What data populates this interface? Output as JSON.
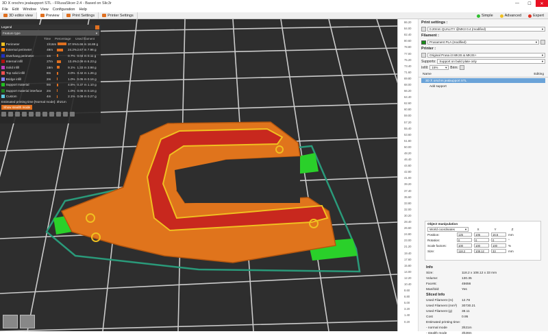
{
  "window": {
    "title": "3D Ⅹ orschrs jealaupport STL - FRusaSlicer-2.4 - Based on Slic3r",
    "controls": [
      "—",
      "☐",
      "✕"
    ]
  },
  "menubar": [
    "File",
    "Edit",
    "Window",
    "View",
    "Configuration",
    "Help"
  ],
  "tabs": [
    {
      "label": "3D editor view"
    },
    {
      "label": "Preview"
    },
    {
      "label": "Print Settings"
    },
    {
      "label": "Printer Settings"
    }
  ],
  "modes": [
    {
      "label": "Simple",
      "color": "#2fbf2f"
    },
    {
      "label": "Advanced",
      "color": "#f0c020"
    },
    {
      "label": "Expert",
      "color": "#e03020"
    }
  ],
  "legend": {
    "title": "Legend",
    "view_type": "Feature type",
    "columns": [
      "",
      "Time",
      "Percentage",
      "",
      "Used filament"
    ],
    "rows": [
      {
        "name": "Perimeter",
        "time": "1h16m",
        "pct": "37.9%",
        "len": "5.66 m 16.88 g",
        "color": "#f0c020",
        "bar": 0.9
      },
      {
        "name": "External perimeter",
        "time": "49m",
        "pct": "24.2%",
        "len": "2.67 m 7.96 g",
        "color": "#ff7f00",
        "bar": 0.6
      },
      {
        "name": "Overhang perimeter",
        "time": "1m",
        "pct": "0.7%",
        "len": "0.04 m 0.11 g",
        "color": "#2030c0",
        "bar": 0.05
      },
      {
        "name": "Internal infill",
        "time": "27m",
        "pct": "13.4%",
        "len": "2.09 m 6.23 g",
        "color": "#b01010",
        "bar": 0.35
      },
      {
        "name": "Solid infill",
        "time": "18m",
        "pct": "9.1%",
        "len": "1.33 m 3.98 g",
        "color": "#c040c0",
        "bar": 0.25
      },
      {
        "name": "Top solid infill",
        "time": "8m",
        "pct": "4.0%",
        "len": "0.42 m 1.26 g",
        "color": "#f05050",
        "bar": 0.12
      },
      {
        "name": "Bridge infill",
        "time": "2m",
        "pct": "1.0%",
        "len": "0.05 m 0.16 g",
        "color": "#8080ff",
        "bar": 0.04
      },
      {
        "name": "Support material",
        "time": "9m",
        "pct": "4.5%",
        "len": "0.37 m 1.10 g",
        "color": "#20c020",
        "bar": 0.13
      },
      {
        "name": "Support material interface",
        "time": "2m",
        "pct": "1.0%",
        "len": "0.06 m 0.18 g",
        "color": "#208020",
        "bar": 0.04
      },
      {
        "name": "Custom",
        "time": "4m",
        "pct": "2.1%",
        "len": "0.09 m 0.27 g",
        "color": "#5ec8e0",
        "bar": 0.06
      }
    ],
    "estimated_label": "Estimated printing time [Normal mode]:",
    "estimated_value": "3h21m",
    "show_button": "Show stealth mode"
  },
  "ruler": [
    "86.20",
    "84.00",
    "82.40",
    "80.60",
    "78.80",
    "77.00",
    "75.20",
    "73.40",
    "71.60",
    "69.80",
    "68.00",
    "66.20",
    "64.40",
    "62.60",
    "60.80",
    "59.00",
    "57.20",
    "55.40",
    "53.60",
    "51.80",
    "50.00",
    "48.20",
    "46.40",
    "44.60",
    "42.80",
    "41.00",
    "39.20",
    "37.40",
    "35.60",
    "33.80",
    "32.00",
    "30.20",
    "28.40",
    "26.60",
    "24.80",
    "23.00",
    "21.20",
    "19.40",
    "17.60",
    "15.80",
    "14.00",
    "12.20",
    "10.40",
    "8.60",
    "6.80",
    "5.00",
    "3.20",
    "1.40",
    "0.20"
  ],
  "panel": {
    "print_settings_label": "Print settings :",
    "print_profile": "0.20mm QUALITY @MK3 0.4 (modified)",
    "filament_label": "Filament :",
    "filament_profile": "Prusament PLA (modified)",
    "filament_color": "#1a8f1a",
    "printer_label": "Printer :",
    "printer_profile": "Original Prusa i3 MK3S & MK3S+",
    "supports_label": "Supports:",
    "supports_value": "Support on build plate only",
    "infill_label": "Infill:",
    "infill_value": "15%",
    "brim_label": "Brim:",
    "list_name_header": "Name",
    "list_editing_header": "Editing",
    "object_name": "3D Ⅹ orschrs jealaupport STL",
    "object_child": "Add support"
  },
  "manipulation": {
    "title": "Object manipulation",
    "coord_system": "World coordinates",
    "axes": [
      "X",
      "Y",
      "Z"
    ],
    "rows": [
      {
        "label": "Position:",
        "values": [
          "125",
          "105",
          "16.5"
        ],
        "unit": "mm"
      },
      {
        "label": "Rotation:",
        "values": [
          "0",
          "0",
          "0"
        ],
        "unit": "°"
      },
      {
        "label": "Scale factors:",
        "values": [
          "100",
          "100",
          "100"
        ],
        "unit": "%"
      },
      {
        "label": "Size:",
        "values": [
          "118.2",
          "108.12",
          "33"
        ],
        "unit": "mm"
      }
    ]
  },
  "info": {
    "title": "Info",
    "size": "118.2 x 108.12 x 33 mm",
    "volume": "130.35",
    "facets": "45656",
    "manifold": "Yes",
    "sliced_title": "Sliced Info",
    "used_filament_m": "12.78",
    "used_filament_mm3": "30730.21",
    "used_filament_g": "38.11",
    "cost": "0.95",
    "est_time_label": "Estimated printing time:",
    "normal_mode": "3h21m",
    "stealth_mode": "3h28m"
  }
}
